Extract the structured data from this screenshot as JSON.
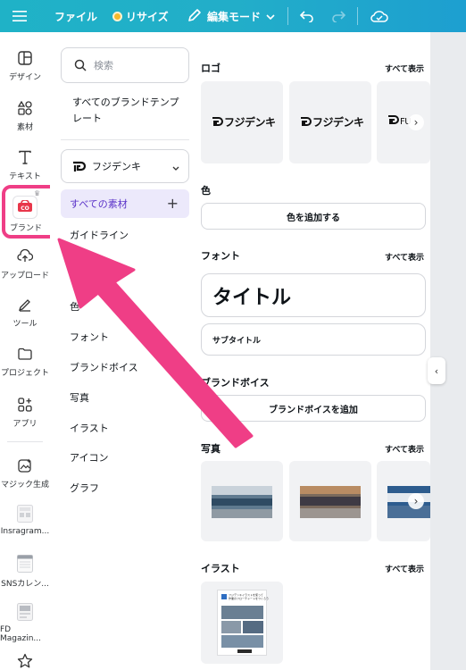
{
  "topbar": {
    "file": "ファイル",
    "resize": "リサイズ",
    "edit_mode": "編集モード"
  },
  "rail": {
    "items": [
      {
        "label": "デザイン",
        "icon": "layout-icon"
      },
      {
        "label": "素材",
        "icon": "shapes-icon"
      },
      {
        "label": "テキスト",
        "icon": "text-icon"
      },
      {
        "label": "ブランド",
        "icon": "brand-icon"
      },
      {
        "label": "アップロード",
        "icon": "cloud-upload-icon"
      },
      {
        "label": "ツール",
        "icon": "pen-tool-icon"
      },
      {
        "label": "プロジェクト",
        "icon": "folder-icon"
      },
      {
        "label": "アプリ",
        "icon": "apps-icon"
      },
      {
        "label": "マジック生成",
        "icon": "magic-media-icon"
      },
      {
        "label": "Insragram...",
        "icon": "instagram-app-icon"
      },
      {
        "label": "SNSカレン...",
        "icon": "calendar-app-icon"
      },
      {
        "label": "FD Magazin...",
        "icon": "magazine-app-icon"
      }
    ]
  },
  "panel": {
    "search_placeholder": "検索",
    "all_templates": "すべてのブランドテンプレート",
    "brand_kit": "フジデンキ",
    "nav": {
      "all_assets": "すべての素材",
      "guidelines": "ガイドライン",
      "colors": "色",
      "fonts": "フォント",
      "brand_voice": "ブランドボイス",
      "photos": "写真",
      "illustrations": "イラスト",
      "icons": "アイコン",
      "graphs": "グラフ"
    }
  },
  "content": {
    "see_all": "すべて表示",
    "logo_title": "ロゴ",
    "logo_text": "フジデンキ",
    "logo_text_partial": "FU",
    "color_title": "色",
    "add_color": "色を追加する",
    "font_title": "フォント",
    "font_heading": "タイトル",
    "font_subheading": "サブタイトル",
    "voice_title": "ブランドボイス",
    "add_voice": "ブランドボイスを追加",
    "photo_title": "写真",
    "illust_title": "イラスト",
    "illust_card_text": "フジデンキイラストを使って\n作業のフローチャートをつくろう"
  },
  "colors": {
    "accent": "#ef3e86",
    "topbar_start": "#1fb2c7",
    "topbar_end": "#1d9fd0",
    "active_nav_bg": "#ece9fb",
    "active_nav_text": "#5a32c8"
  }
}
